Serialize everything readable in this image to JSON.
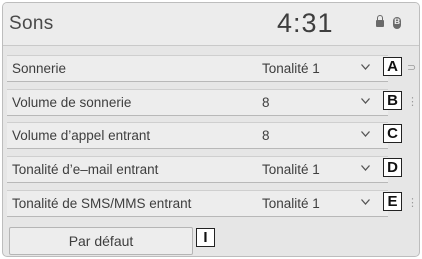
{
  "header": {
    "title": "Sons",
    "time": "4:31",
    "status_icons": [
      "lock-icon",
      "bluetooth-icon"
    ]
  },
  "settings": [
    {
      "label": "Sonnerie",
      "value": "Tonalité 1",
      "callout": "A"
    },
    {
      "label": "Volume de sonnerie",
      "value": "8",
      "callout": "B"
    },
    {
      "label": "Volume d’appel entrant",
      "value": "8",
      "callout": "C"
    },
    {
      "label": "Tonalité d’e–mail entrant",
      "value": "Tonalité 1",
      "callout": "D"
    },
    {
      "label": "Tonalité de SMS/MMS entrant",
      "value": "Tonalité 1",
      "callout": "E"
    }
  ],
  "footer": {
    "default_button": "Par défaut",
    "callout": "I"
  }
}
